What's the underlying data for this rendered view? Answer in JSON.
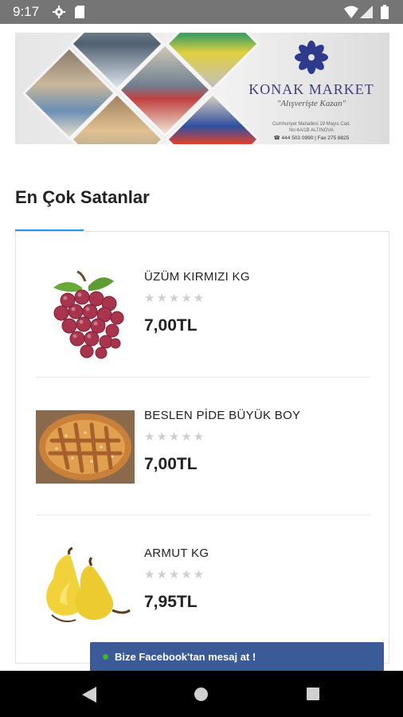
{
  "status_bar": {
    "time": "9:17",
    "icons": [
      "gear-icon",
      "sd-card-icon",
      "wifi-icon",
      "signal-icon",
      "battery-icon"
    ]
  },
  "banner": {
    "brand": "KONAK MARKET",
    "slogan": "\"Alışverişte Kazan\"",
    "address_line1": "Cumhuriyet Mahallesi 19 Mayıs Cad.",
    "address_line2": "No:4A/1B ALTINOVA",
    "phones": "☎ 444 503 0990 | Fax 275 8825",
    "accent_color": "#2e3a8c"
  },
  "section": {
    "title": "En Çok Satanlar",
    "accent_color": "#2196f3"
  },
  "products": [
    {
      "name": "ÜZÜM KIRMIZI KG",
      "price": "7,00TL",
      "rating": 0,
      "stars": "★★★★★",
      "image_icon": "grapes-image"
    },
    {
      "name": "BESLEN PİDE BÜYÜK BOY",
      "price": "7,00TL",
      "rating": 0,
      "stars": "★★★★★",
      "image_icon": "pide-bread-image"
    },
    {
      "name": "ARMUT KG",
      "price": "7,95TL",
      "rating": 0,
      "stars": "★★★★★",
      "image_icon": "pear-image"
    }
  ],
  "facebook_bar": {
    "label": "Bize Facebook'tan mesaj at !",
    "color": "#3a5a98"
  },
  "nav_bar": {
    "buttons": [
      "back-icon",
      "home-icon",
      "recents-icon"
    ]
  }
}
